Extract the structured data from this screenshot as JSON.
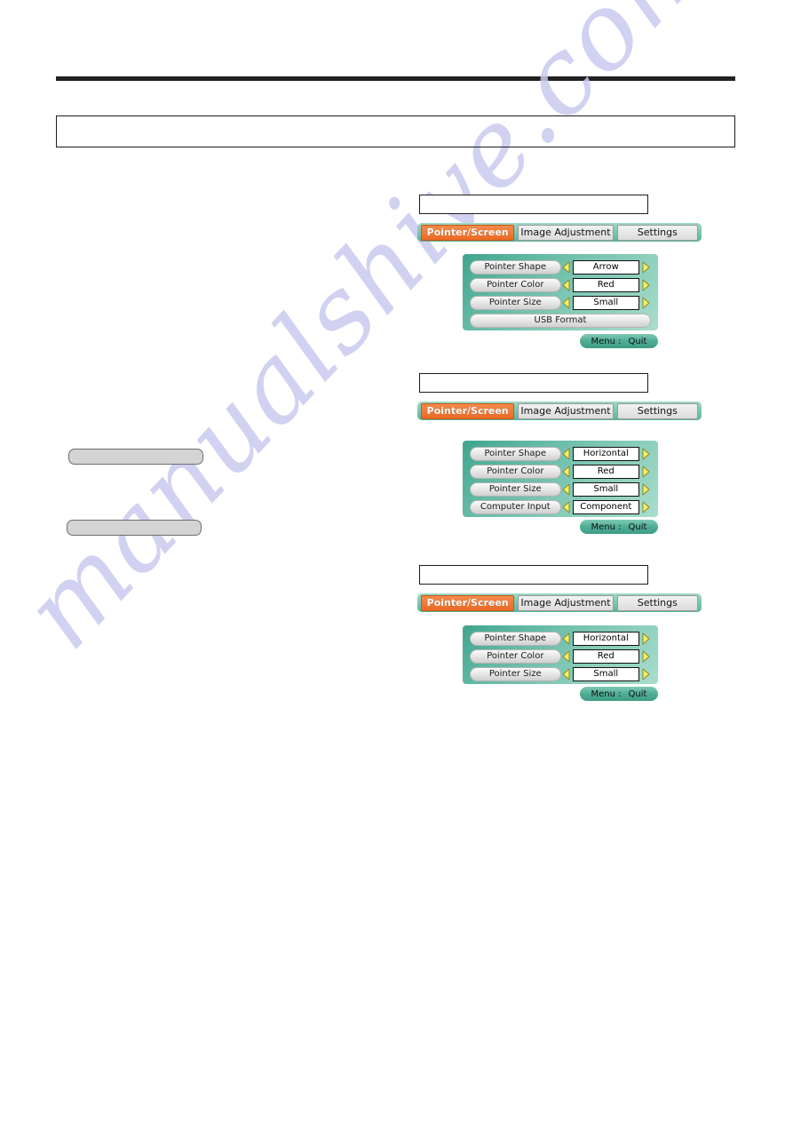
{
  "page": {
    "watermark": "manualshive.com",
    "header_caption": "",
    "note_one": "",
    "note_two": ""
  },
  "colors": {
    "accent_orange": "#ea6a25",
    "panel_teal": "#63b9a4",
    "tabbar_teal": "#7fc9b4",
    "arrow_yellow": "#f2ee6b",
    "value_border": "#111111",
    "gray_pill": "#d4d4d4"
  },
  "osd_common": {
    "tabs": [
      {
        "label": "Pointer/Screen",
        "active": true
      },
      {
        "label": "Image Adjustment",
        "active": false
      },
      {
        "label": "Settings",
        "active": false
      }
    ],
    "quit": {
      "menu_label": "Menu :",
      "action_label": "Quit"
    },
    "left_arrow_icon": "triangle-left-icon",
    "right_arrow_icon": "triangle-right-icon"
  },
  "osd_menus": [
    {
      "id": "menu-1",
      "caption": "",
      "rows": [
        {
          "label": "Pointer Shape",
          "value": "Arrow",
          "has_arrows": true
        },
        {
          "label": "Pointer Color",
          "value": "Red",
          "has_arrows": true
        },
        {
          "label": "Pointer Size",
          "value": "Small",
          "has_arrows": true
        },
        {
          "label": "USB Format",
          "value": "",
          "has_arrows": false
        }
      ]
    },
    {
      "id": "menu-2",
      "caption": "",
      "rows": [
        {
          "label": "Pointer Shape",
          "value": "Horizontal",
          "has_arrows": true
        },
        {
          "label": "Pointer Color",
          "value": "Red",
          "has_arrows": true
        },
        {
          "label": "Pointer Size",
          "value": "Small",
          "has_arrows": true
        },
        {
          "label": "Computer Input",
          "value": "Component",
          "has_arrows": true
        }
      ]
    },
    {
      "id": "menu-3",
      "caption": "",
      "rows": [
        {
          "label": "Pointer Shape",
          "value": "Horizontal",
          "has_arrows": true
        },
        {
          "label": "Pointer Color",
          "value": "Red",
          "has_arrows": true
        },
        {
          "label": "Pointer Size",
          "value": "Small",
          "has_arrows": true
        }
      ]
    }
  ]
}
